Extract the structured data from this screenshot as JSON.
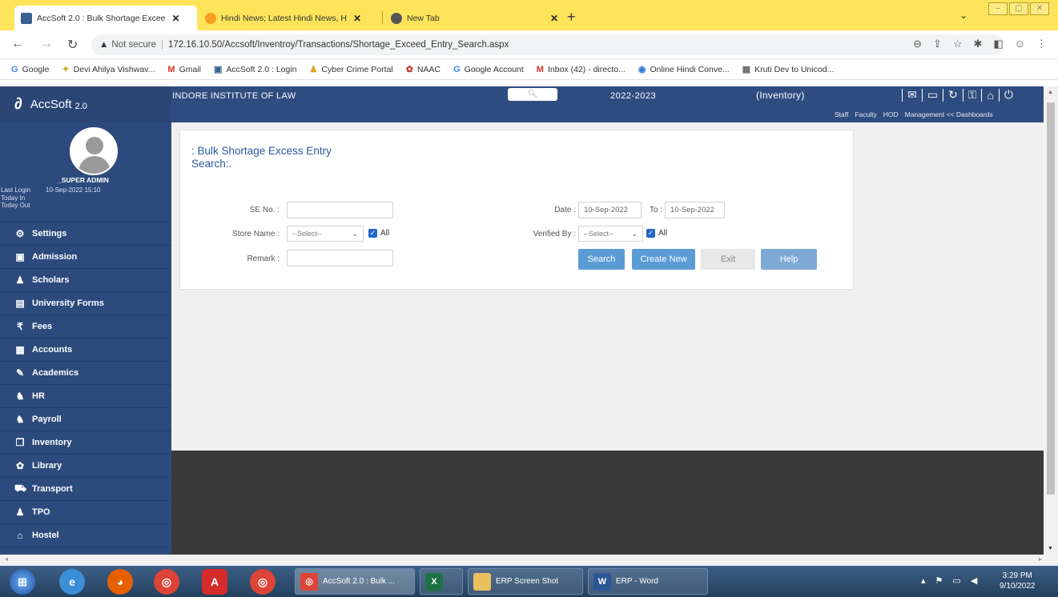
{
  "browser": {
    "tabs": [
      {
        "title": "AccSoft 2.0 : Bulk Shortage Excee"
      },
      {
        "title": "Hindi News; Latest Hindi News, H"
      },
      {
        "title": "New Tab"
      }
    ],
    "not_secure": "Not secure",
    "url": "172.16.10.50/Accsoft/Inventroy/Transactions/Shortage_Exceed_Entry_Search.aspx",
    "bookmarks": [
      {
        "icon": "G",
        "label": "Google"
      },
      {
        "icon": "✦",
        "label": "Devi Ahilya Vishwav..."
      },
      {
        "icon": "M",
        "label": "Gmail"
      },
      {
        "icon": "▣",
        "label": "AccSoft 2.0 : Login"
      },
      {
        "icon": "♟",
        "label": "Cyber Crime Portal"
      },
      {
        "icon": "✿",
        "label": "NAAC"
      },
      {
        "icon": "G",
        "label": "Google Account"
      },
      {
        "icon": "M",
        "label": "Inbox (42) - directo..."
      },
      {
        "icon": "◉",
        "label": "Online Hindi Conve..."
      },
      {
        "icon": "▦",
        "label": "Kruti Dev to Unicod..."
      }
    ]
  },
  "header": {
    "brand": "AccSoft",
    "version": "2.0",
    "institute": "INDORE INSTITUTE OF LAW",
    "session": "2022-2023",
    "module": "(Inventory)",
    "links": [
      "Staff",
      "Faculty",
      "HOD",
      "Management << Dashboards"
    ]
  },
  "profile": {
    "name": "_SUPER ADMIN",
    "last_login_label": "Last Login",
    "last_login_value": "10-Sep-2022 15:10",
    "today_in": "Today In",
    "today_out": "Today Out"
  },
  "menu": [
    {
      "icon": "gear-icon",
      "glyph": "⚙",
      "label": "Settings"
    },
    {
      "icon": "admission-icon",
      "glyph": "▣",
      "label": "Admission"
    },
    {
      "icon": "user-icon",
      "glyph": "♟",
      "label": "Scholars"
    },
    {
      "icon": "form-icon",
      "glyph": "▤",
      "label": "University Forms"
    },
    {
      "icon": "rupee-icon",
      "glyph": "₹",
      "label": "Fees"
    },
    {
      "icon": "ledger-icon",
      "glyph": "▦",
      "label": "Accounts"
    },
    {
      "icon": "pencil-icon",
      "glyph": "✎",
      "label": "Academics"
    },
    {
      "icon": "group-icon",
      "glyph": "♞",
      "label": "HR"
    },
    {
      "icon": "group-icon",
      "glyph": "♞",
      "label": "Payroll"
    },
    {
      "icon": "inventory-icon",
      "glyph": "❐",
      "label": "Inventory"
    },
    {
      "icon": "library-icon",
      "glyph": "✿",
      "label": "Library"
    },
    {
      "icon": "car-icon",
      "glyph": "⛟",
      "label": "Transport"
    },
    {
      "icon": "user-icon",
      "glyph": "♟",
      "label": "TPO"
    },
    {
      "icon": "home-icon",
      "glyph": "⌂",
      "label": "Hostel"
    }
  ],
  "form": {
    "title": ": Bulk Shortage Excess Entry",
    "subtitle": "Search:.",
    "se_no_label": "SE No. :",
    "se_no_value": "",
    "store_label": "Store Name :",
    "store_value": "--Select--",
    "all_label": "All",
    "remark_label": "Remark :",
    "remark_value": "",
    "date_label": "Date :",
    "date_from": "10-Sep-2022",
    "to_label": "To :",
    "date_to": "10-Sep-2022",
    "verified_label": "Verified By :",
    "verified_value": "--Select--",
    "buttons": {
      "search": "Search",
      "create": "Create New",
      "exit": "Exit",
      "help": "Help"
    }
  },
  "taskbar": {
    "tasks": [
      {
        "label": "AccSoft 2.0 : Bulk ..."
      },
      {
        "label": ""
      },
      {
        "label": "ERP Screen Shot"
      },
      {
        "label": "ERP - Word"
      }
    ],
    "time": "3:29 PM",
    "date": "9/10/2022"
  },
  "colors": {
    "header": "#2e4c7f",
    "sidebar": "#2d4a7c",
    "accent": "#5b9bd5",
    "tabbar": "#fde45a"
  }
}
